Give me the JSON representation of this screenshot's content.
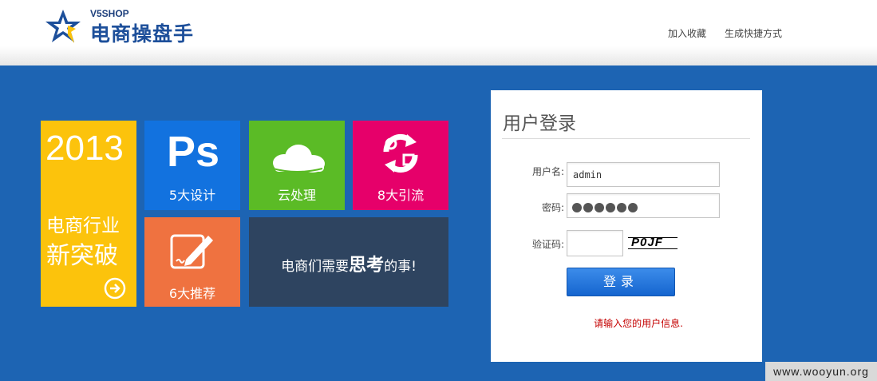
{
  "header": {
    "logo_small": "V5SHOP",
    "logo_big": "电商操盘手",
    "links": [
      "加入收藏",
      "生成快捷方式"
    ]
  },
  "tiles": {
    "promo": {
      "year": "2013",
      "line1": "电商行业",
      "line2": "新突破"
    },
    "ps": {
      "glyph": "Ps",
      "label": "5大设计"
    },
    "cloud": {
      "label": "云处理"
    },
    "traffic": {
      "label": "8大引流"
    },
    "recommend": {
      "label": "6大推荐"
    },
    "slogan": {
      "pre": "电商们需要",
      "emph": "思考",
      "post": "的事!"
    }
  },
  "login": {
    "title": "用户登录",
    "username_label": "用户名:",
    "username_value": "admin",
    "password_label": "密码:",
    "password_mask_count": 6,
    "captcha_label": "验证码:",
    "captcha_text": "P0JF",
    "submit_label": "登录",
    "message": "请输入您的用户信息."
  },
  "watermark": "www.wooyun.org",
  "colors": {
    "main_bg": "#1d64b3",
    "yellow": "#fcc30c",
    "blue": "#1272df",
    "green": "#5bbb26",
    "pink": "#e6006a",
    "orange": "#ef7240",
    "dark": "#2e4460",
    "message": "#c40000"
  }
}
